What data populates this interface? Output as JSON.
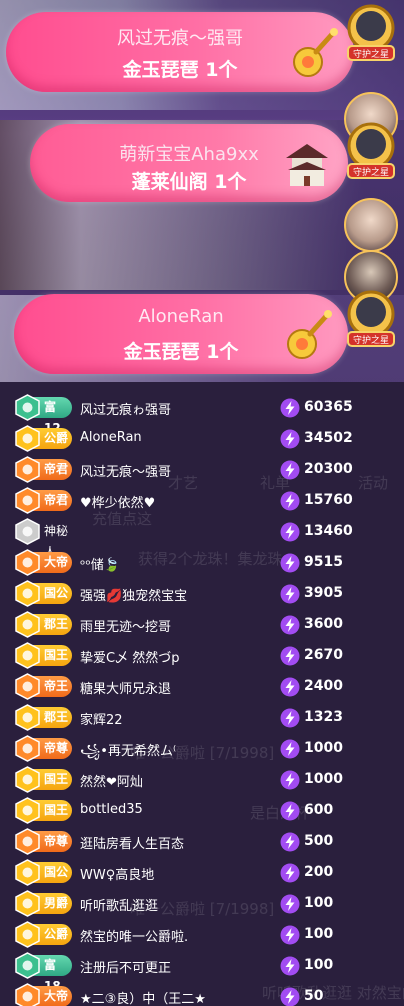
{
  "banners": [
    {
      "gifter": "风过无痕～强哥",
      "gift": "金玉琵琶 1个",
      "gift_icon": "pipa-icon"
    },
    {
      "gifter": "萌新宝宝Aha9xx",
      "gift": "蓬莱仙阁 1个",
      "gift_icon": "pavilion-icon"
    },
    {
      "gifter": "AloneRan",
      "gift": "金玉琵琶 1个",
      "gift_icon": "pipa-icon"
    }
  ],
  "guard_badge_label": "守护之星",
  "background_overlay": {
    "tabs": [
      "才艺",
      "礼单",
      "活动"
    ],
    "recharge": "充值点这",
    "lines": [
      "获得2个龙珠！集龙珠，",
      "唯一公爵啦 [7/1998]",
      "是白泽杯",
      "唯一公爵啦 [7/1998]",
      "听听歌乱逛逛 对然宝的唯一公"
    ]
  },
  "ranking": [
    {
      "badge": "富12",
      "badge_style": "green",
      "name": "风过无痕ゎ强哥",
      "score": "60365"
    },
    {
      "badge": "公爵",
      "badge_style": "gold",
      "name": "AloneRan",
      "score": "34502"
    },
    {
      "badge": "帝君",
      "badge_style": "orange",
      "name": "风过无痕～强哥",
      "score": "20300"
    },
    {
      "badge": "帝君",
      "badge_style": "orange",
      "name": "♥桦少依然♥",
      "score": "15760"
    },
    {
      "badge": "神秘人",
      "badge_style": "plain",
      "name": "",
      "score": "13460"
    },
    {
      "badge": "大帝",
      "badge_style": "orange",
      "name": "ᵒᵒ储🍃",
      "score": "9515"
    },
    {
      "badge": "国公",
      "badge_style": "gold",
      "name": "强强💋独宠然宝宝",
      "score": "3905"
    },
    {
      "badge": "郡王",
      "badge_style": "gold",
      "name": "雨里无迹～挖哥",
      "score": "3600"
    },
    {
      "badge": "国王",
      "badge_style": "gold",
      "name": "挚爱C乄 然然づp",
      "score": "2670"
    },
    {
      "badge": "帝王",
      "badge_style": "orange",
      "name": "糖果大师兄永退",
      "score": "2400"
    },
    {
      "badge": "郡王",
      "badge_style": "gold",
      "name": "家辉22",
      "score": "1323"
    },
    {
      "badge": "帝尊",
      "badge_style": "orange",
      "name": "꧁•再无希然ム⁽",
      "score": "1000"
    },
    {
      "badge": "国王",
      "badge_style": "gold",
      "name": "然然❤阿灿",
      "score": "1000"
    },
    {
      "badge": "国王",
      "badge_style": "gold",
      "name": "bottled35",
      "score": "600"
    },
    {
      "badge": "帝尊",
      "badge_style": "orange",
      "name": "逛陆房看人生百态",
      "score": "500"
    },
    {
      "badge": "国公",
      "badge_style": "gold",
      "name": "WW♀高良地",
      "score": "200"
    },
    {
      "badge": "男爵",
      "badge_style": "gold",
      "name": "听听歌乱逛逛",
      "score": "100"
    },
    {
      "badge": "公爵",
      "badge_style": "gold",
      "name": "然宝的唯一公爵啦.",
      "score": "100"
    },
    {
      "badge": "富18",
      "badge_style": "green",
      "name": "注册后不可更正",
      "score": "100"
    },
    {
      "badge": "大帝",
      "badge_style": "orange",
      "name": "★二③良）中（王二★",
      "score": "50"
    }
  ],
  "colors": {
    "banner_pink": "#ff4d8f",
    "badge_gold": "#f5a40f",
    "badge_orange": "#f06a1a",
    "badge_green": "#2fa884",
    "bolt_purple": "#a24cf2"
  }
}
